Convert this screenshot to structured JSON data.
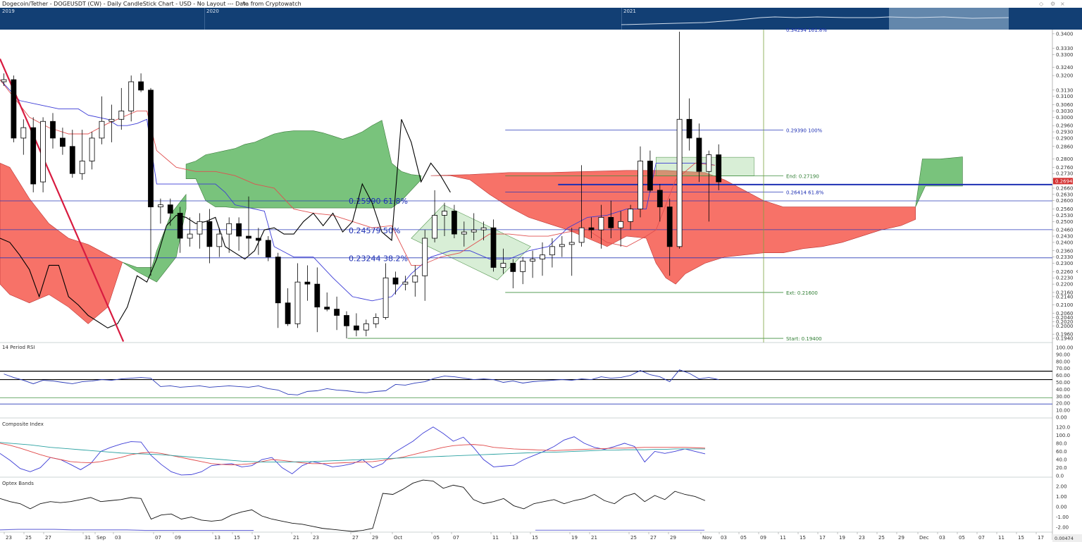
{
  "header": {
    "title": "Dogecoin/Tether - DOGEUSDT (CW) - Daily CandleStick Chart - USD - No Layout --- Data from Cryptowatch",
    "edit_icon": "pencil-icon",
    "window_controls": [
      "diamond-icon",
      "settings-icon",
      "close-icon"
    ]
  },
  "navigator": {
    "years": [
      "2019",
      "2020",
      "2021"
    ]
  },
  "colors": {
    "bull_candle": "#ffffff",
    "bear_candle": "#000000",
    "cloud_bull": "#4caf50",
    "cloud_bear": "#f44336",
    "tenkan": "#e05050",
    "kijun": "#3b3bd6",
    "chikou": "#000000",
    "trendline": "#d81b40",
    "price_highlight": "#d32f2f"
  },
  "chart_data": [
    {
      "type": "candlestick",
      "panel": "price",
      "ylim": [
        0.192,
        0.342
      ],
      "ytick_values": [
        0.34,
        0.333,
        0.33,
        0.324,
        0.32,
        0.313,
        0.31,
        0.306,
        0.303,
        0.3,
        0.296,
        0.293,
        0.29,
        0.286,
        0.28,
        0.276,
        0.273,
        0.27,
        0.266,
        0.263,
        0.26,
        0.256,
        0.253,
        0.25,
        0.246,
        0.243,
        0.24,
        0.236,
        0.233,
        0.23,
        0.226,
        0.223,
        0.22,
        0.216,
        0.214,
        0.21,
        0.206,
        0.204,
        0.202,
        0.2,
        0.196,
        0.194
      ],
      "ytick_labels": [
        "0.3400",
        "0.3330",
        "0.3300",
        "0.3240",
        "0.3200",
        "0.3130",
        "0.3100",
        "0.3060",
        "0.3030",
        "0.3000",
        "0.2960",
        "0.2930",
        "0.2900",
        "0.2860",
        "0.2800",
        "0.2760",
        "0.2730",
        "0.2700",
        "0.2660",
        "0.2630",
        "0.2600",
        "0.2560",
        "0.2530",
        "0.2500",
        "0.2460",
        "0.2430",
        "0.2400",
        "0.2360",
        "0.2330",
        "0.2300",
        "0.2260",
        "0.2230",
        "0.2200",
        "0.2160",
        "0.2140",
        "0.2100",
        "0.2060",
        "0.2040",
        "0.2020",
        "0.2000",
        "0.1960",
        "0.1940"
      ],
      "current_price_label": "0.2694",
      "current_price": 0.2694,
      "x_tick_labels": [
        "23",
        "25",
        "27",
        "31",
        "Sep",
        "03",
        "07",
        "09",
        "13",
        "15",
        "17",
        "21",
        "23",
        "27",
        "29",
        "Oct",
        "05",
        "07",
        "11",
        "13",
        "15",
        "19",
        "21",
        "25",
        "27",
        "29",
        "Nov",
        "03",
        "05",
        "09",
        "11",
        "15",
        "17",
        "19",
        "23",
        "25",
        "29",
        "Dec",
        "03",
        "05",
        "07",
        "11",
        "15",
        "17"
      ],
      "candles": [
        {
          "o": 0.317,
          "h": 0.321,
          "l": 0.315,
          "c": 0.318
        },
        {
          "o": 0.318,
          "h": 0.32,
          "l": 0.288,
          "c": 0.29
        },
        {
          "o": 0.29,
          "h": 0.299,
          "l": 0.282,
          "c": 0.295
        },
        {
          "o": 0.295,
          "h": 0.3,
          "l": 0.264,
          "c": 0.268
        },
        {
          "o": 0.269,
          "h": 0.3,
          "l": 0.264,
          "c": 0.298
        },
        {
          "o": 0.298,
          "h": 0.302,
          "l": 0.285,
          "c": 0.29
        },
        {
          "o": 0.29,
          "h": 0.295,
          "l": 0.282,
          "c": 0.286
        },
        {
          "o": 0.286,
          "h": 0.294,
          "l": 0.271,
          "c": 0.273
        },
        {
          "o": 0.273,
          "h": 0.294,
          "l": 0.27,
          "c": 0.279
        },
        {
          "o": 0.279,
          "h": 0.293,
          "l": 0.275,
          "c": 0.29
        },
        {
          "o": 0.29,
          "h": 0.31,
          "l": 0.287,
          "c": 0.298
        },
        {
          "o": 0.298,
          "h": 0.306,
          "l": 0.288,
          "c": 0.299
        },
        {
          "o": 0.299,
          "h": 0.314,
          "l": 0.294,
          "c": 0.303
        },
        {
          "o": 0.303,
          "h": 0.32,
          "l": 0.298,
          "c": 0.317
        },
        {
          "o": 0.317,
          "h": 0.321,
          "l": 0.312,
          "c": 0.313
        },
        {
          "o": 0.313,
          "h": 0.314,
          "l": 0.224,
          "c": 0.257
        },
        {
          "o": 0.257,
          "h": 0.261,
          "l": 0.249,
          "c": 0.258
        },
        {
          "o": 0.258,
          "h": 0.261,
          "l": 0.248,
          "c": 0.254
        },
        {
          "o": 0.254,
          "h": 0.257,
          "l": 0.235,
          "c": 0.242
        },
        {
          "o": 0.242,
          "h": 0.252,
          "l": 0.238,
          "c": 0.244
        },
        {
          "o": 0.244,
          "h": 0.254,
          "l": 0.237,
          "c": 0.25
        },
        {
          "o": 0.25,
          "h": 0.256,
          "l": 0.23,
          "c": 0.238
        },
        {
          "o": 0.238,
          "h": 0.247,
          "l": 0.233,
          "c": 0.244
        },
        {
          "o": 0.244,
          "h": 0.252,
          "l": 0.235,
          "c": 0.249
        },
        {
          "o": 0.249,
          "h": 0.252,
          "l": 0.236,
          "c": 0.243
        },
        {
          "o": 0.243,
          "h": 0.262,
          "l": 0.234,
          "c": 0.242
        },
        {
          "o": 0.242,
          "h": 0.247,
          "l": 0.234,
          "c": 0.241
        },
        {
          "o": 0.241,
          "h": 0.243,
          "l": 0.231,
          "c": 0.233
        },
        {
          "o": 0.233,
          "h": 0.235,
          "l": 0.199,
          "c": 0.211
        },
        {
          "o": 0.211,
          "h": 0.218,
          "l": 0.2,
          "c": 0.201
        },
        {
          "o": 0.201,
          "h": 0.23,
          "l": 0.199,
          "c": 0.221
        },
        {
          "o": 0.221,
          "h": 0.229,
          "l": 0.212,
          "c": 0.22
        },
        {
          "o": 0.22,
          "h": 0.228,
          "l": 0.197,
          "c": 0.209
        },
        {
          "o": 0.209,
          "h": 0.216,
          "l": 0.207,
          "c": 0.208
        },
        {
          "o": 0.208,
          "h": 0.214,
          "l": 0.198,
          "c": 0.205
        },
        {
          "o": 0.205,
          "h": 0.207,
          "l": 0.194,
          "c": 0.2
        },
        {
          "o": 0.2,
          "h": 0.206,
          "l": 0.195,
          "c": 0.198
        },
        {
          "o": 0.198,
          "h": 0.203,
          "l": 0.195,
          "c": 0.201
        },
        {
          "o": 0.201,
          "h": 0.206,
          "l": 0.199,
          "c": 0.204
        },
        {
          "o": 0.204,
          "h": 0.23,
          "l": 0.203,
          "c": 0.223
        },
        {
          "o": 0.223,
          "h": 0.226,
          "l": 0.215,
          "c": 0.22
        },
        {
          "o": 0.22,
          "h": 0.224,
          "l": 0.217,
          "c": 0.221
        },
        {
          "o": 0.221,
          "h": 0.229,
          "l": 0.214,
          "c": 0.224
        },
        {
          "o": 0.224,
          "h": 0.246,
          "l": 0.212,
          "c": 0.242
        },
        {
          "o": 0.242,
          "h": 0.265,
          "l": 0.24,
          "c": 0.253
        },
        {
          "o": 0.253,
          "h": 0.259,
          "l": 0.243,
          "c": 0.255
        },
        {
          "o": 0.255,
          "h": 0.258,
          "l": 0.242,
          "c": 0.244
        },
        {
          "o": 0.244,
          "h": 0.25,
          "l": 0.238,
          "c": 0.245
        },
        {
          "o": 0.245,
          "h": 0.254,
          "l": 0.241,
          "c": 0.246
        },
        {
          "o": 0.246,
          "h": 0.25,
          "l": 0.241,
          "c": 0.247
        },
        {
          "o": 0.247,
          "h": 0.251,
          "l": 0.226,
          "c": 0.228
        },
        {
          "o": 0.228,
          "h": 0.237,
          "l": 0.225,
          "c": 0.23
        },
        {
          "o": 0.23,
          "h": 0.232,
          "l": 0.218,
          "c": 0.226
        },
        {
          "o": 0.226,
          "h": 0.233,
          "l": 0.22,
          "c": 0.231
        },
        {
          "o": 0.231,
          "h": 0.236,
          "l": 0.223,
          "c": 0.232
        },
        {
          "o": 0.232,
          "h": 0.24,
          "l": 0.224,
          "c": 0.234
        },
        {
          "o": 0.234,
          "h": 0.242,
          "l": 0.228,
          "c": 0.238
        },
        {
          "o": 0.238,
          "h": 0.243,
          "l": 0.233,
          "c": 0.239
        },
        {
          "o": 0.239,
          "h": 0.247,
          "l": 0.224,
          "c": 0.24
        },
        {
          "o": 0.24,
          "h": 0.277,
          "l": 0.238,
          "c": 0.247
        },
        {
          "o": 0.247,
          "h": 0.252,
          "l": 0.242,
          "c": 0.246
        },
        {
          "o": 0.246,
          "h": 0.258,
          "l": 0.237,
          "c": 0.252
        },
        {
          "o": 0.252,
          "h": 0.26,
          "l": 0.242,
          "c": 0.247
        },
        {
          "o": 0.247,
          "h": 0.255,
          "l": 0.238,
          "c": 0.25
        },
        {
          "o": 0.25,
          "h": 0.258,
          "l": 0.246,
          "c": 0.256
        },
        {
          "o": 0.256,
          "h": 0.286,
          "l": 0.252,
          "c": 0.279
        },
        {
          "o": 0.279,
          "h": 0.284,
          "l": 0.264,
          "c": 0.265
        },
        {
          "o": 0.265,
          "h": 0.268,
          "l": 0.25,
          "c": 0.257
        },
        {
          "o": 0.257,
          "h": 0.261,
          "l": 0.224,
          "c": 0.238
        },
        {
          "o": 0.238,
          "h": 0.341,
          "l": 0.237,
          "c": 0.299
        },
        {
          "o": 0.299,
          "h": 0.309,
          "l": 0.284,
          "c": 0.29
        },
        {
          "o": 0.29,
          "h": 0.297,
          "l": 0.269,
          "c": 0.274
        },
        {
          "o": 0.274,
          "h": 0.284,
          "l": 0.25,
          "c": 0.282
        },
        {
          "o": 0.282,
          "h": 0.287,
          "l": 0.265,
          "c": 0.269
        }
      ],
      "fibonacci": [
        {
          "label": "0.25990 61.8%",
          "value": 0.2599
        },
        {
          "label": "0.24579 50%",
          "value": 0.24579
        },
        {
          "label": "0.23244 38.2%",
          "value": 0.23244
        },
        {
          "label": "0.29390 100%",
          "value": 0.2939
        },
        {
          "label": "0.26414 61.8%",
          "value": 0.26414
        }
      ],
      "annotations": [
        {
          "label": "End: 0.27190",
          "value": 0.2719
        },
        {
          "label": "Ext: 0.21600",
          "value": 0.216
        },
        {
          "label": "Start: 0.19400",
          "value": 0.194
        },
        {
          "label": "0.34294 161.8%",
          "value": 0.34294
        }
      ],
      "horizontal_levels": [
        0.2677,
        0.2599,
        0.2461,
        0.2326
      ]
    },
    {
      "type": "line",
      "panel": "rsi",
      "title": "14 Period RSI",
      "ylim": [
        0,
        100
      ],
      "ytick_labels": [
        "100.00",
        "90.00",
        "80.00",
        "70.00",
        "60.00",
        "50.00",
        "40.00",
        "30.00",
        "20.00",
        "10.00",
        "0.00"
      ],
      "levels": [
        66,
        54,
        28,
        19
      ],
      "values": [
        62,
        57,
        53,
        48,
        53,
        52,
        50,
        48,
        51,
        52,
        54,
        53,
        55,
        56,
        57,
        56,
        44,
        45,
        43,
        44,
        45,
        43,
        44,
        45,
        44,
        43,
        45,
        41,
        39,
        33,
        32,
        37,
        38,
        41,
        39,
        38,
        36,
        35,
        37,
        38,
        47,
        46,
        49,
        51,
        56,
        59,
        58,
        56,
        54,
        55,
        54,
        50,
        52,
        49,
        51,
        52,
        53,
        54,
        53,
        55,
        54,
        58,
        56,
        57,
        60,
        67,
        61,
        58,
        51,
        68,
        63,
        55,
        57,
        54
      ]
    },
    {
      "type": "line",
      "panel": "composite",
      "title": "Composite Index",
      "ylim": [
        -5,
        130
      ],
      "ytick_labels": [
        "120.0",
        "100.0",
        "80.0",
        "60.0",
        "40.0",
        "20.0",
        "0.0"
      ],
      "series": [
        {
          "color": "#3b3bd6",
          "values": [
            55,
            38,
            18,
            10,
            20,
            45,
            40,
            28,
            15,
            30,
            60,
            70,
            78,
            84,
            83,
            50,
            28,
            10,
            2,
            3,
            10,
            25,
            28,
            30,
            22,
            25,
            40,
            45,
            20,
            5,
            25,
            35,
            30,
            22,
            25,
            30,
            40,
            20,
            30,
            55,
            70,
            85,
            105,
            120,
            104,
            85,
            95,
            70,
            40,
            22,
            24,
            26,
            40,
            50,
            60,
            72,
            88,
            96,
            80,
            70,
            65,
            72,
            80,
            72,
            34,
            60,
            55,
            60,
            66,
            60,
            54
          ]
        },
        {
          "color": "#e04848",
          "values": [
            80,
            75,
            68,
            60,
            52,
            45,
            40,
            35,
            33,
            32,
            35,
            40,
            45,
            52,
            56,
            58,
            55,
            50,
            45,
            40,
            35,
            30,
            28,
            27,
            28,
            30,
            35,
            40,
            38,
            35,
            32,
            30,
            30,
            31,
            32,
            33,
            34,
            35,
            38,
            42,
            46,
            52,
            58,
            64,
            70,
            74,
            76,
            77,
            75,
            70,
            68,
            66,
            65,
            64,
            63,
            62,
            63,
            64,
            65,
            66,
            67,
            68,
            68,
            69,
            70,
            70,
            70,
            70,
            70,
            69,
            68
          ]
        },
        {
          "color": "#2aa1a1",
          "values": [
            82,
            80,
            78,
            76,
            73,
            70,
            68,
            66,
            64,
            62,
            60,
            58,
            56,
            55,
            54,
            53,
            52,
            50,
            48,
            46,
            44,
            42,
            40,
            38,
            36,
            35,
            34,
            34,
            34,
            34,
            35,
            35,
            36,
            37,
            38,
            39,
            40,
            41,
            42,
            43,
            44,
            45,
            46,
            47,
            48,
            49,
            50,
            51,
            52,
            53,
            54,
            55,
            56,
            57,
            58,
            58,
            59,
            60,
            61,
            62,
            63,
            63,
            64,
            64,
            64,
            65,
            65,
            66,
            66,
            66,
            66
          ]
        }
      ]
    },
    {
      "type": "line",
      "panel": "optex",
      "title": "Optex Bands",
      "ylim": [
        -2.4,
        2.4
      ],
      "ytick_labels": [
        "2.00",
        "1.00",
        "0.00",
        "-1.00",
        "-2.00"
      ],
      "values": [
        0.8,
        0.5,
        0.3,
        -0.2,
        0.3,
        0.5,
        0.4,
        0.5,
        0.7,
        0.9,
        0.5,
        0.6,
        0.7,
        0.9,
        0.8,
        -1.2,
        -0.8,
        -0.7,
        -1.2,
        -1.0,
        -1.3,
        -1.4,
        -1.3,
        -0.8,
        -0.5,
        -0.3,
        -0.9,
        -1.2,
        -1.4,
        -1.6,
        -1.7,
        -1.9,
        -2.1,
        -2.2,
        -2.3,
        -2.4,
        -2.3,
        -2.1,
        1.3,
        1.2,
        1.7,
        2.3,
        2.6,
        2.5,
        1.8,
        2.1,
        1.9,
        0.7,
        0.3,
        0.5,
        0.8,
        0.1,
        -0.2,
        0.3,
        0.5,
        0.7,
        0.3,
        0.6,
        0.8,
        1.2,
        0.6,
        0.3,
        1.0,
        1.3,
        0.5,
        1.1,
        0.7,
        1.5,
        1.2,
        1.0,
        0.6
      ],
      "lower_band_values": [
        -2.25,
        -2.2,
        -2.2,
        -2.2,
        -2.25,
        -2.25,
        -2.25,
        -2.25,
        -2.3,
        -2.3,
        -2.3,
        -2.3,
        -2.3,
        -2.3,
        -2.3
      ]
    }
  ]
}
